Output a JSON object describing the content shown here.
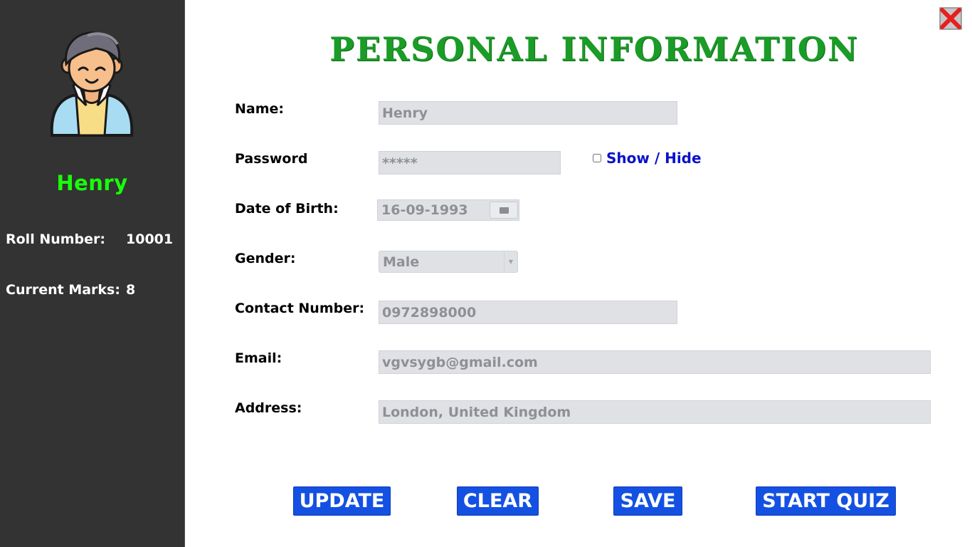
{
  "sidebar": {
    "student_name": "Henry",
    "roll_label": "Roll Number:",
    "roll_value": "10001",
    "marks_label": "Current Marks:",
    "marks_value": "8"
  },
  "header": {
    "title": "PERSONAL INFORMATION"
  },
  "form": {
    "name": {
      "label": "Name:",
      "value": "Henry"
    },
    "password": {
      "label": "Password",
      "value": "*****",
      "toggle_label": "Show / Hide"
    },
    "dob": {
      "label": "Date of Birth:",
      "value": "16-09-1993"
    },
    "gender": {
      "label": "Gender:",
      "value": "Male"
    },
    "contact": {
      "label": "Contact Number:",
      "value": "0972898000"
    },
    "email": {
      "label": "Email:",
      "value": "vgvsygb@gmail.com"
    },
    "address": {
      "label": "Address:",
      "value": "London, United Kingdom"
    }
  },
  "buttons": {
    "update": "UPDATE",
    "clear": "CLEAR",
    "save": "SAVE",
    "start_quiz": "START QUIZ"
  },
  "icons": {
    "close": "close-icon",
    "avatar": "user-avatar-icon",
    "calendar": "calendar-icon",
    "dropdown": "chevron-down-icon"
  },
  "colors": {
    "sidebar_bg": "#333333",
    "name_green": "#19ff0b",
    "title_green": "#1a9c27",
    "button_blue": "#1451e3",
    "link_blue": "#0a12c8",
    "field_bg": "#dfe1e5",
    "close_red": "#e81f1f"
  }
}
